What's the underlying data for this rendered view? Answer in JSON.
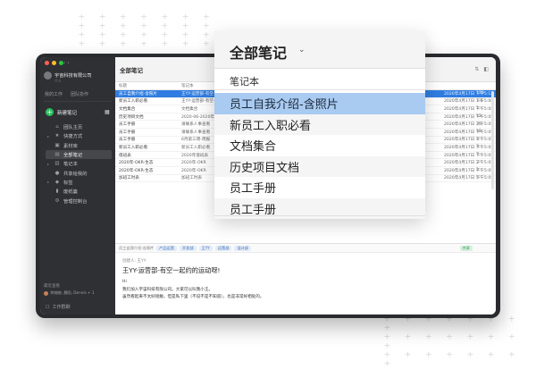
{
  "sidebar": {
    "account_name": "宇宙科技有限公司",
    "account_sub": "个人",
    "top_items": [
      "我的工作",
      "团队协作"
    ],
    "new_note_label": "新建笔记",
    "nav_items": [
      {
        "label": "团队主页",
        "icon": "home-icon"
      },
      {
        "label": "快捷方式",
        "icon": "star-icon"
      },
      {
        "label": "素材库",
        "icon": "image-icon"
      },
      {
        "label": "全部笔记",
        "icon": "notes-icon",
        "active": true
      },
      {
        "label": "笔记本",
        "icon": "notebook-icon"
      },
      {
        "label": "共享给我的",
        "icon": "share-icon"
      },
      {
        "label": "标签",
        "icon": "tag-icon"
      },
      {
        "label": "废纸篓",
        "icon": "trash-icon"
      },
      {
        "label": "管理控制台",
        "icon": "admin-icon"
      }
    ],
    "share_title": "最近查看",
    "share_people": "李婉婉, 晨阳, Dennis + 1",
    "work_chat": "工作群聊"
  },
  "notes_list": {
    "title": "全部笔记",
    "columns": {
      "title": "标题",
      "notebook": "笔记本"
    },
    "rows": [
      {
        "title": "员工自我介绍-含照片",
        "notebook": "王YY-运营部-有空一起",
        "date": "2020年4月17日 下午5:12",
        "size": "179",
        "selected": true
      },
      {
        "title": "新员工入职必看",
        "notebook": "王YY-运营部-有空一起",
        "date": "2020年4月17日 下午5:08",
        "size": "1.1"
      },
      {
        "title": "文档集合",
        "notebook": "文档集合",
        "date": "2020年4月17日 下午5:08",
        "size": "1"
      },
      {
        "title": "历史项目文档",
        "notebook": "2020-06-2020年-01",
        "date": "2020年4月17日 下午5:05",
        "size": "13"
      },
      {
        "title": "员工手册",
        "notebook": "请联系人事查看",
        "date": "2020年4月17日 下午5:05",
        "size": "25"
      },
      {
        "title": "员工手册",
        "notebook": "请联系人事查看",
        "date": "2020年4月17日 下午5:05",
        "size": "19"
      },
      {
        "title": "员工手册",
        "notebook": "6月第三周-周报",
        "date": "2020年4月17日 下午5:05",
        "size": "4"
      },
      {
        "title": "新员工入职必看",
        "notebook": "新员工入职必看",
        "date": "2020年4月17日 下午5:05",
        "size": "3"
      },
      {
        "title": "值班表",
        "notebook": "2020年值班表",
        "date": "2020年4月17日 下午5:05",
        "size": "7"
      },
      {
        "title": "2020年-OKR-生态",
        "notebook": "2020年-OKR",
        "date": "2020年4月17日 下午5:05",
        "size": "2"
      },
      {
        "title": "2020年-OKR-生态",
        "notebook": "2020年-OKR",
        "date": "2020年4月17日 下午5:05",
        "size": "2"
      },
      {
        "title": "加班工时表",
        "notebook": "加班工时表",
        "date": "2020年4月17日 下午5:05",
        "size": "5"
      }
    ]
  },
  "note_toolbar": {
    "crumb": "员工自我介绍-含照片",
    "tags": [
      "产品运营",
      "开发部",
      "王YY",
      "运营部",
      "设计部"
    ],
    "status": "共享"
  },
  "editor": {
    "meta": "创建人: 王YY",
    "title": "王YY-运营部-有空一起约的运动呀!",
    "line1": "Hi",
    "line2": "我们加入宇宙科技有限公司。大家可以叫我小王。",
    "line3": "虽然看起来不太好接触，但是私下里（不说不是不知道），也是非常好相处的。"
  },
  "popup": {
    "title": "全部笔记",
    "column_label": "笔记本",
    "items": [
      "员工自我介绍-含照片",
      "新员工入职必看",
      "文档集合",
      "历史项目文档",
      "员工手册",
      "员工手册"
    ],
    "selected_index": 0
  }
}
